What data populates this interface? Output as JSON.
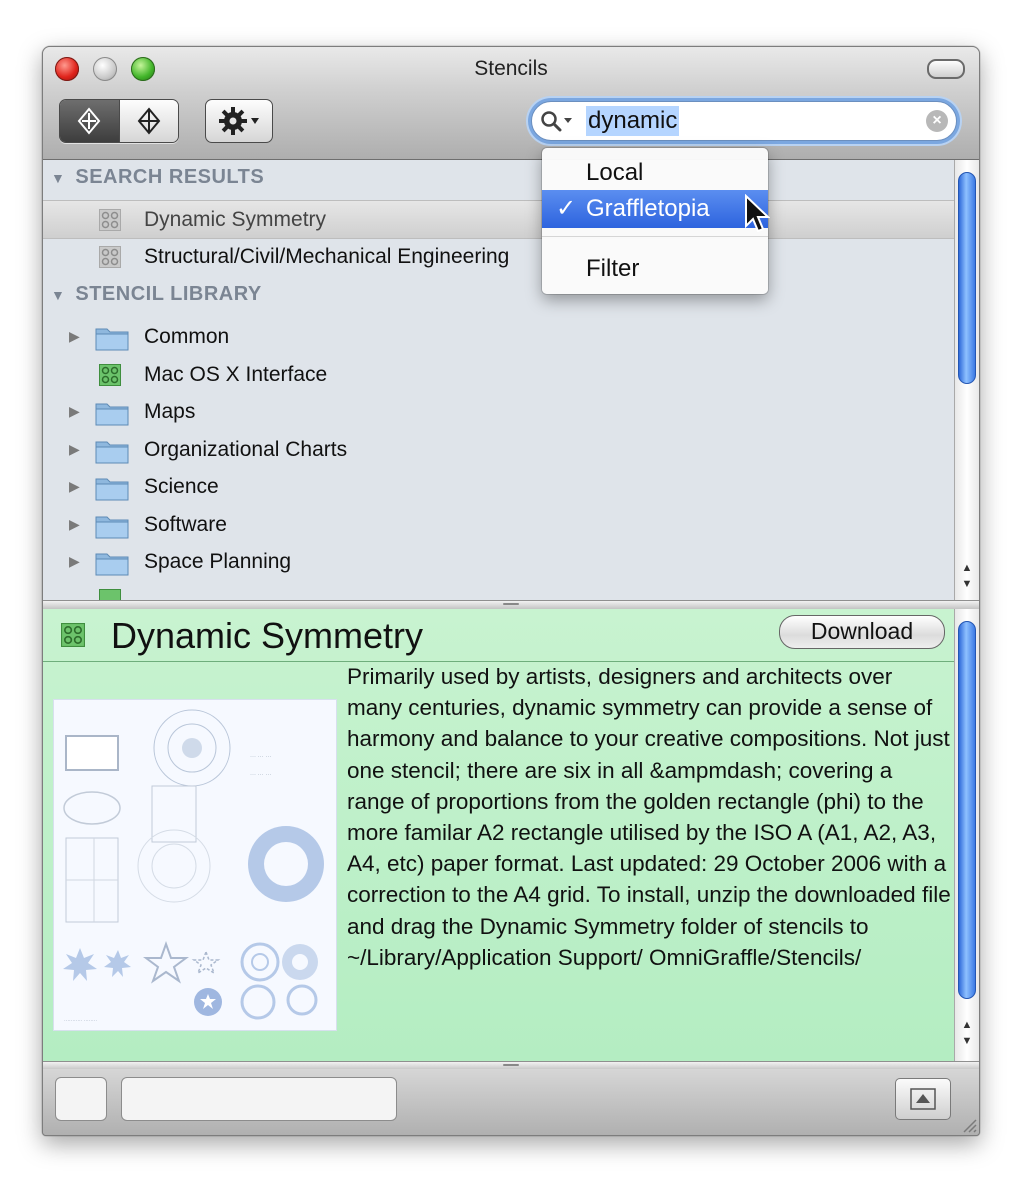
{
  "window": {
    "title": "Stencils"
  },
  "search": {
    "query": "dynamic"
  },
  "search_menu": {
    "items": [
      {
        "label": "Local",
        "checked": false,
        "highlighted": false
      },
      {
        "label": "Graffletopia",
        "checked": true,
        "highlighted": true
      },
      {
        "label": "Filter",
        "checked": false,
        "highlighted": false
      }
    ],
    "check_glyph": "✓"
  },
  "sections": {
    "search_results": "SEARCH RESULTS",
    "stencil_library": "STENCIL LIBRARY"
  },
  "search_results": [
    "Dynamic Symmetry",
    "Structural/Civil/Mechanical Engineering"
  ],
  "library_items": [
    "Common",
    "Mac OS X Interface",
    "Maps",
    "Organizational Charts",
    "Science",
    "Software",
    "Space Planning"
  ],
  "detail": {
    "title": "Dynamic Symmetry",
    "download_label": "Download",
    "description": "Primarily used by artists, designers and architects over many centuries, dynamic symmetry can provide a sense of harmony and balance to your creative compositions. Not just one stencil; there are six in all &ampmdash; covering a range of proportions from the golden rectangle (phi) to the more familar A2 rectangle utilised by the ISO A (A1, A2, A3, A4, etc) paper format. Last updated: 29 October 2006 with a correction to the A4 grid. To install, unzip the downloaded file and drag the Dynamic Symmetry folder of stencils to ~/Library/Application Support/ OmniGraffle/Stencils/"
  },
  "colors": {
    "selection_blue": "#2d63de",
    "detail_green": "#b4edc2",
    "list_background": "#dfe4ea",
    "stencil_green": "#6cc36b"
  },
  "icons": [
    "close-icon",
    "minimize-icon",
    "zoom-icon",
    "toolbar-pill-icon",
    "stencil-mode-icon",
    "browse-mode-icon",
    "gear-icon",
    "search-icon",
    "clear-search-icon",
    "folder-icon",
    "stencil-icon",
    "eject-icon",
    "resize-grip-icon"
  ]
}
